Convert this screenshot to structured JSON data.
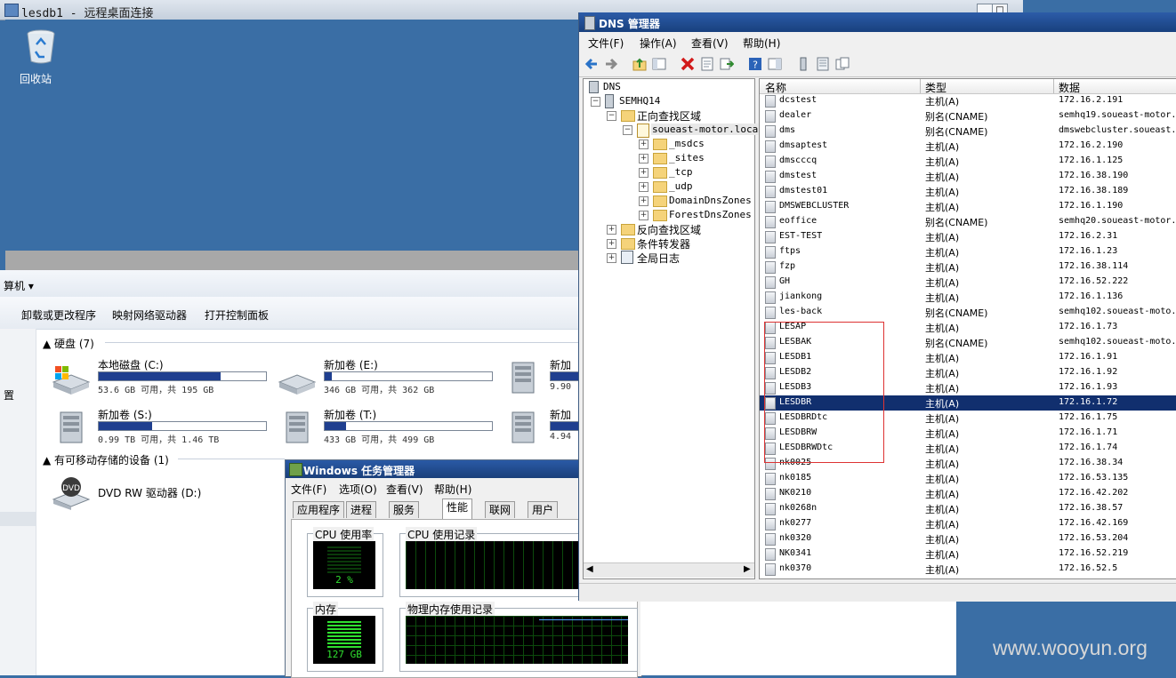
{
  "rdp": {
    "title": "lesdb1 - 远程桌面连接"
  },
  "desktop": {
    "recycle_bin": "回收站"
  },
  "explorer": {
    "crumb": "算机 ▾",
    "toolbar": [
      "卸载或更改程序",
      "映射网络驱动器",
      "打开控制面板"
    ],
    "nav_label": "置",
    "hdd_section": "硬盘 (7)",
    "removable_section": "有可移动存储的设备 (1)",
    "drives": [
      {
        "name": "本地磁盘 (C:)",
        "info": "53.6 GB 可用，共 195 GB",
        "used": 0.73
      },
      {
        "name": "新加卷 (E:)",
        "info": "346 GB 可用，共 362 GB",
        "used": 0.04
      },
      {
        "name": "新加",
        "info": "9.90",
        "used": 0.9
      },
      {
        "name": "新加卷 (S:)",
        "info": "0.99 TB 可用，共 1.46 TB",
        "used": 0.32
      },
      {
        "name": "新加卷 (T:)",
        "info": "433 GB 可用，共 499 GB",
        "used": 0.13
      },
      {
        "name": "新加",
        "info": "4.94",
        "used": 0.9
      }
    ],
    "dvd": "DVD RW 驱动器 (D:)",
    "dvd_icon_text": "DVD"
  },
  "taskmgr": {
    "title": "Windows 任务管理器",
    "menu": [
      "文件(F)",
      "选项(O)",
      "查看(V)",
      "帮助(H)"
    ],
    "tabs": [
      "应用程序",
      "进程",
      "服务",
      "性能",
      "联网",
      "用户"
    ],
    "active_tab": "性能",
    "cpu_usage_label": "CPU 使用率",
    "cpu_usage_value": "2 %",
    "cpu_history_label": "CPU 使用记录",
    "mem_label": "内存",
    "mem_value": "127 GB",
    "mem_history_label": "物理内存使用记录"
  },
  "dns": {
    "title": "DNS 管理器",
    "menu": [
      "文件(F)",
      "操作(A)",
      "查看(V)",
      "帮助(H)"
    ],
    "tree": {
      "root": "DNS",
      "server": "SEMHQ14",
      "forward": "正向查找区域",
      "zone": "soueast-motor.local",
      "children": [
        "_msdcs",
        "_sites",
        "_tcp",
        "_udp",
        "DomainDnsZones",
        "ForestDnsZones"
      ],
      "reverse": "反向查找区域",
      "forwarders": "条件转发器",
      "logs": "全局日志"
    },
    "columns": [
      "名称",
      "类型",
      "数据"
    ],
    "rows": [
      [
        "dcstest",
        "主机(A)",
        "172.16.2.191"
      ],
      [
        "dealer",
        "别名(CNAME)",
        "semhq19.soueast-motor."
      ],
      [
        "dms",
        "别名(CNAME)",
        "dmswebcluster.soueast."
      ],
      [
        "dmsaptest",
        "主机(A)",
        "172.16.2.190"
      ],
      [
        "dmscccq",
        "主机(A)",
        "172.16.1.125"
      ],
      [
        "dmstest",
        "主机(A)",
        "172.16.38.190"
      ],
      [
        "dmstest01",
        "主机(A)",
        "172.16.38.189"
      ],
      [
        "DMSWEBCLUSTER",
        "主机(A)",
        "172.16.1.190"
      ],
      [
        "eoffice",
        "别名(CNAME)",
        "semhq20.soueast-motor."
      ],
      [
        "EST-TEST",
        "主机(A)",
        "172.16.2.31"
      ],
      [
        "ftps",
        "主机(A)",
        "172.16.1.23"
      ],
      [
        "fzp",
        "主机(A)",
        "172.16.38.114"
      ],
      [
        "GH",
        "主机(A)",
        "172.16.52.222"
      ],
      [
        "jiankong",
        "主机(A)",
        "172.16.1.136"
      ],
      [
        "les-back",
        "别名(CNAME)",
        "semhq102.soueast-moto."
      ],
      [
        "LESAP",
        "主机(A)",
        "172.16.1.73"
      ],
      [
        "LESBAK",
        "别名(CNAME)",
        "semhq102.soueast-moto."
      ],
      [
        "LESDB1",
        "主机(A)",
        "172.16.1.91"
      ],
      [
        "LESDB2",
        "主机(A)",
        "172.16.1.92"
      ],
      [
        "LESDB3",
        "主机(A)",
        "172.16.1.93"
      ],
      [
        "LESDBR",
        "主机(A)",
        "172.16.1.72"
      ],
      [
        "LESDBRDtc",
        "主机(A)",
        "172.16.1.75"
      ],
      [
        "LESDBRW",
        "主机(A)",
        "172.16.1.71"
      ],
      [
        "LESDBRWDtc",
        "主机(A)",
        "172.16.1.74"
      ],
      [
        "nk0025",
        "主机(A)",
        "172.16.38.34"
      ],
      [
        "nk0185",
        "主机(A)",
        "172.16.53.135"
      ],
      [
        "NK0210",
        "主机(A)",
        "172.16.42.202"
      ],
      [
        "nk0268n",
        "主机(A)",
        "172.16.38.57"
      ],
      [
        "nk0277",
        "主机(A)",
        "172.16.42.169"
      ],
      [
        "nk0320",
        "主机(A)",
        "172.16.53.204"
      ],
      [
        "NK0341",
        "主机(A)",
        "172.16.52.219"
      ],
      [
        "nk0370",
        "主机(A)",
        "172.16.52.5"
      ]
    ],
    "selected_name": "LESDBR"
  },
  "watermark": "www.wooyun.org"
}
